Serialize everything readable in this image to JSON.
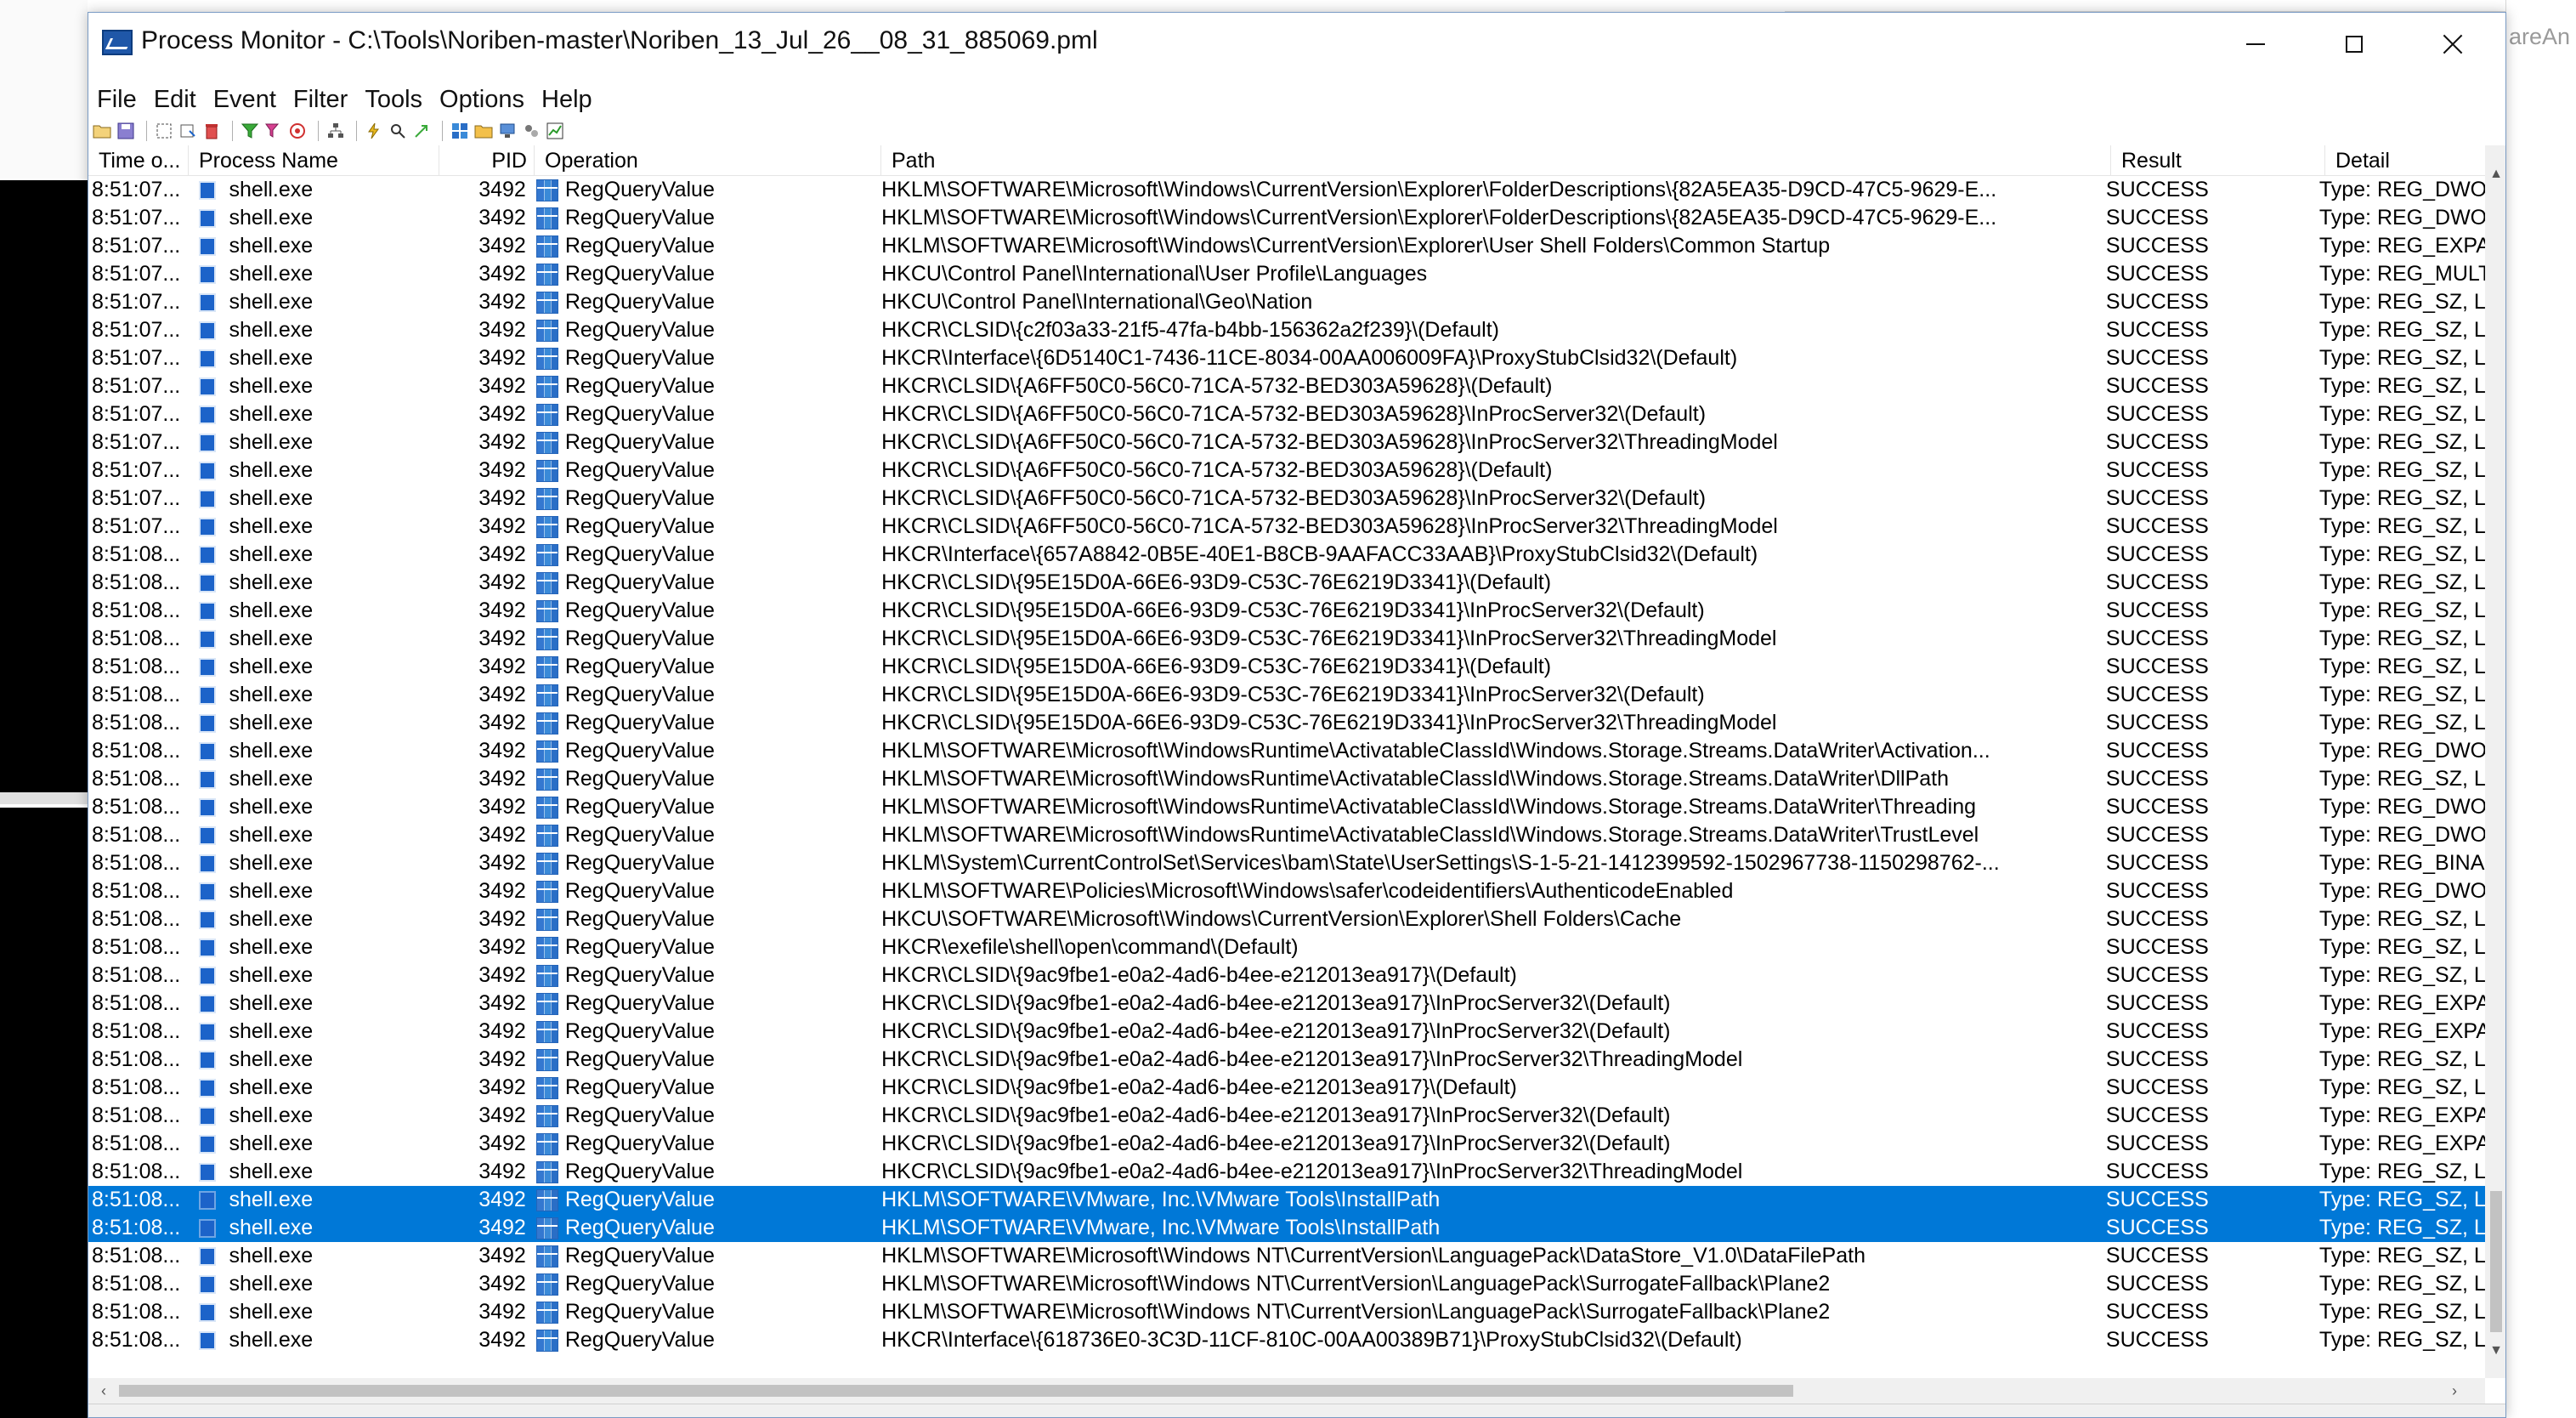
{
  "window": {
    "title": "Process Monitor - C:\\Tools\\Noriben-master\\Noriben_13_Jul_26__08_31_885069.pml",
    "controls": {
      "minimize": "minimize",
      "maximize": "maximize",
      "close": "close"
    }
  },
  "background": {
    "right_text": "areAn"
  },
  "menu": [
    "File",
    "Edit",
    "Event",
    "Filter",
    "Tools",
    "Options",
    "Help"
  ],
  "toolbar": {
    "icons": [
      "open-icon",
      "save-icon",
      "capture-icon",
      "autoscroll-icon",
      "clear-icon",
      "filter-icon",
      "edit-filter-icon",
      "highlight-icon",
      "process-tree-icon",
      "event-properties-icon",
      "find-icon",
      "jump-icon",
      "registry-icon",
      "filesystem-icon",
      "network-icon",
      "process-icon",
      "profiling-icon"
    ]
  },
  "columns": [
    "Time o...",
    "Process Name",
    "PID",
    "Operation",
    "Path",
    "Result",
    "Detail"
  ],
  "rows": [
    {
      "time": "8:51:07...",
      "process": "shell.exe",
      "pid": "3492",
      "op": "RegQueryValue",
      "path": "HKLM\\SOFTWARE\\Microsoft\\Windows\\CurrentVersion\\Explorer\\FolderDescriptions\\{82A5EA35-D9CD-47C5-9629-E...",
      "result": "SUCCESS",
      "detail": "Type: REG_DWOI"
    },
    {
      "time": "8:51:07...",
      "process": "shell.exe",
      "pid": "3492",
      "op": "RegQueryValue",
      "path": "HKLM\\SOFTWARE\\Microsoft\\Windows\\CurrentVersion\\Explorer\\FolderDescriptions\\{82A5EA35-D9CD-47C5-9629-E...",
      "result": "SUCCESS",
      "detail": "Type: REG_DWOI"
    },
    {
      "time": "8:51:07...",
      "process": "shell.exe",
      "pid": "3492",
      "op": "RegQueryValue",
      "path": "HKLM\\SOFTWARE\\Microsoft\\Windows\\CurrentVersion\\Explorer\\User Shell Folders\\Common Startup",
      "result": "SUCCESS",
      "detail": "Type: REG_EXPA"
    },
    {
      "time": "8:51:07...",
      "process": "shell.exe",
      "pid": "3492",
      "op": "RegQueryValue",
      "path": "HKCU\\Control Panel\\International\\User Profile\\Languages",
      "result": "SUCCESS",
      "detail": "Type: REG_MULT"
    },
    {
      "time": "8:51:07...",
      "process": "shell.exe",
      "pid": "3492",
      "op": "RegQueryValue",
      "path": "HKCU\\Control Panel\\International\\Geo\\Nation",
      "result": "SUCCESS",
      "detail": "Type: REG_SZ, Le"
    },
    {
      "time": "8:51:07...",
      "process": "shell.exe",
      "pid": "3492",
      "op": "RegQueryValue",
      "path": "HKCR\\CLSID\\{c2f03a33-21f5-47fa-b4bb-156362a2f239}\\(Default)",
      "result": "SUCCESS",
      "detail": "Type: REG_SZ, Le"
    },
    {
      "time": "8:51:07...",
      "process": "shell.exe",
      "pid": "3492",
      "op": "RegQueryValue",
      "path": "HKCR\\Interface\\{6D5140C1-7436-11CE-8034-00AA006009FA}\\ProxyStubClsid32\\(Default)",
      "result": "SUCCESS",
      "detail": "Type: REG_SZ, Le"
    },
    {
      "time": "8:51:07...",
      "process": "shell.exe",
      "pid": "3492",
      "op": "RegQueryValue",
      "path": "HKCR\\CLSID\\{A6FF50C0-56C0-71CA-5732-BED303A59628}\\(Default)",
      "result": "SUCCESS",
      "detail": "Type: REG_SZ, Le"
    },
    {
      "time": "8:51:07...",
      "process": "shell.exe",
      "pid": "3492",
      "op": "RegQueryValue",
      "path": "HKCR\\CLSID\\{A6FF50C0-56C0-71CA-5732-BED303A59628}\\InProcServer32\\(Default)",
      "result": "SUCCESS",
      "detail": "Type: REG_SZ, Le"
    },
    {
      "time": "8:51:07...",
      "process": "shell.exe",
      "pid": "3492",
      "op": "RegQueryValue",
      "path": "HKCR\\CLSID\\{A6FF50C0-56C0-71CA-5732-BED303A59628}\\InProcServer32\\ThreadingModel",
      "result": "SUCCESS",
      "detail": "Type: REG_SZ, Le"
    },
    {
      "time": "8:51:07...",
      "process": "shell.exe",
      "pid": "3492",
      "op": "RegQueryValue",
      "path": "HKCR\\CLSID\\{A6FF50C0-56C0-71CA-5732-BED303A59628}\\(Default)",
      "result": "SUCCESS",
      "detail": "Type: REG_SZ, Le"
    },
    {
      "time": "8:51:07...",
      "process": "shell.exe",
      "pid": "3492",
      "op": "RegQueryValue",
      "path": "HKCR\\CLSID\\{A6FF50C0-56C0-71CA-5732-BED303A59628}\\InProcServer32\\(Default)",
      "result": "SUCCESS",
      "detail": "Type: REG_SZ, Le"
    },
    {
      "time": "8:51:07...",
      "process": "shell.exe",
      "pid": "3492",
      "op": "RegQueryValue",
      "path": "HKCR\\CLSID\\{A6FF50C0-56C0-71CA-5732-BED303A59628}\\InProcServer32\\ThreadingModel",
      "result": "SUCCESS",
      "detail": "Type: REG_SZ, Le"
    },
    {
      "time": "8:51:08...",
      "process": "shell.exe",
      "pid": "3492",
      "op": "RegQueryValue",
      "path": "HKCR\\Interface\\{657A8842-0B5E-40E1-B8CB-9AAFACC33AAB}\\ProxyStubClsid32\\(Default)",
      "result": "SUCCESS",
      "detail": "Type: REG_SZ, Le"
    },
    {
      "time": "8:51:08...",
      "process": "shell.exe",
      "pid": "3492",
      "op": "RegQueryValue",
      "path": "HKCR\\CLSID\\{95E15D0A-66E6-93D9-C53C-76E6219D3341}\\(Default)",
      "result": "SUCCESS",
      "detail": "Type: REG_SZ, Le"
    },
    {
      "time": "8:51:08...",
      "process": "shell.exe",
      "pid": "3492",
      "op": "RegQueryValue",
      "path": "HKCR\\CLSID\\{95E15D0A-66E6-93D9-C53C-76E6219D3341}\\InProcServer32\\(Default)",
      "result": "SUCCESS",
      "detail": "Type: REG_SZ, Le"
    },
    {
      "time": "8:51:08...",
      "process": "shell.exe",
      "pid": "3492",
      "op": "RegQueryValue",
      "path": "HKCR\\CLSID\\{95E15D0A-66E6-93D9-C53C-76E6219D3341}\\InProcServer32\\ThreadingModel",
      "result": "SUCCESS",
      "detail": "Type: REG_SZ, Le"
    },
    {
      "time": "8:51:08...",
      "process": "shell.exe",
      "pid": "3492",
      "op": "RegQueryValue",
      "path": "HKCR\\CLSID\\{95E15D0A-66E6-93D9-C53C-76E6219D3341}\\(Default)",
      "result": "SUCCESS",
      "detail": "Type: REG_SZ, Le"
    },
    {
      "time": "8:51:08...",
      "process": "shell.exe",
      "pid": "3492",
      "op": "RegQueryValue",
      "path": "HKCR\\CLSID\\{95E15D0A-66E6-93D9-C53C-76E6219D3341}\\InProcServer32\\(Default)",
      "result": "SUCCESS",
      "detail": "Type: REG_SZ, Le"
    },
    {
      "time": "8:51:08...",
      "process": "shell.exe",
      "pid": "3492",
      "op": "RegQueryValue",
      "path": "HKCR\\CLSID\\{95E15D0A-66E6-93D9-C53C-76E6219D3341}\\InProcServer32\\ThreadingModel",
      "result": "SUCCESS",
      "detail": "Type: REG_SZ, Le"
    },
    {
      "time": "8:51:08...",
      "process": "shell.exe",
      "pid": "3492",
      "op": "RegQueryValue",
      "path": "HKLM\\SOFTWARE\\Microsoft\\WindowsRuntime\\ActivatableClassId\\Windows.Storage.Streams.DataWriter\\Activation...",
      "result": "SUCCESS",
      "detail": "Type: REG_DWOI"
    },
    {
      "time": "8:51:08...",
      "process": "shell.exe",
      "pid": "3492",
      "op": "RegQueryValue",
      "path": "HKLM\\SOFTWARE\\Microsoft\\WindowsRuntime\\ActivatableClassId\\Windows.Storage.Streams.DataWriter\\DllPath",
      "result": "SUCCESS",
      "detail": "Type: REG_SZ, Le"
    },
    {
      "time": "8:51:08...",
      "process": "shell.exe",
      "pid": "3492",
      "op": "RegQueryValue",
      "path": "HKLM\\SOFTWARE\\Microsoft\\WindowsRuntime\\ActivatableClassId\\Windows.Storage.Streams.DataWriter\\Threading",
      "result": "SUCCESS",
      "detail": "Type: REG_DWOI"
    },
    {
      "time": "8:51:08...",
      "process": "shell.exe",
      "pid": "3492",
      "op": "RegQueryValue",
      "path": "HKLM\\SOFTWARE\\Microsoft\\WindowsRuntime\\ActivatableClassId\\Windows.Storage.Streams.DataWriter\\TrustLevel",
      "result": "SUCCESS",
      "detail": "Type: REG_DWOI"
    },
    {
      "time": "8:51:08...",
      "process": "shell.exe",
      "pid": "3492",
      "op": "RegQueryValue",
      "path": "HKLM\\System\\CurrentControlSet\\Services\\bam\\State\\UserSettings\\S-1-5-21-1412399592-1502967738-1150298762-...",
      "result": "SUCCESS",
      "detail": "Type: REG_BINAI"
    },
    {
      "time": "8:51:08...",
      "process": "shell.exe",
      "pid": "3492",
      "op": "RegQueryValue",
      "path": "HKLM\\SOFTWARE\\Policies\\Microsoft\\Windows\\safer\\codeidentifiers\\AuthenticodeEnabled",
      "result": "SUCCESS",
      "detail": "Type: REG_DWOI"
    },
    {
      "time": "8:51:08...",
      "process": "shell.exe",
      "pid": "3492",
      "op": "RegQueryValue",
      "path": "HKCU\\SOFTWARE\\Microsoft\\Windows\\CurrentVersion\\Explorer\\Shell Folders\\Cache",
      "result": "SUCCESS",
      "detail": "Type: REG_SZ, Le"
    },
    {
      "time": "8:51:08...",
      "process": "shell.exe",
      "pid": "3492",
      "op": "RegQueryValue",
      "path": "HKCR\\exefile\\shell\\open\\command\\(Default)",
      "result": "SUCCESS",
      "detail": "Type: REG_SZ, Le"
    },
    {
      "time": "8:51:08...",
      "process": "shell.exe",
      "pid": "3492",
      "op": "RegQueryValue",
      "path": "HKCR\\CLSID\\{9ac9fbe1-e0a2-4ad6-b4ee-e212013ea917}\\(Default)",
      "result": "SUCCESS",
      "detail": "Type: REG_SZ, Le"
    },
    {
      "time": "8:51:08...",
      "process": "shell.exe",
      "pid": "3492",
      "op": "RegQueryValue",
      "path": "HKCR\\CLSID\\{9ac9fbe1-e0a2-4ad6-b4ee-e212013ea917}\\InProcServer32\\(Default)",
      "result": "SUCCESS",
      "detail": "Type: REG_EXPA"
    },
    {
      "time": "8:51:08...",
      "process": "shell.exe",
      "pid": "3492",
      "op": "RegQueryValue",
      "path": "HKCR\\CLSID\\{9ac9fbe1-e0a2-4ad6-b4ee-e212013ea917}\\InProcServer32\\(Default)",
      "result": "SUCCESS",
      "detail": "Type: REG_EXPA"
    },
    {
      "time": "8:51:08...",
      "process": "shell.exe",
      "pid": "3492",
      "op": "RegQueryValue",
      "path": "HKCR\\CLSID\\{9ac9fbe1-e0a2-4ad6-b4ee-e212013ea917}\\InProcServer32\\ThreadingModel",
      "result": "SUCCESS",
      "detail": "Type: REG_SZ, Le"
    },
    {
      "time": "8:51:08...",
      "process": "shell.exe",
      "pid": "3492",
      "op": "RegQueryValue",
      "path": "HKCR\\CLSID\\{9ac9fbe1-e0a2-4ad6-b4ee-e212013ea917}\\(Default)",
      "result": "SUCCESS",
      "detail": "Type: REG_SZ, Le"
    },
    {
      "time": "8:51:08...",
      "process": "shell.exe",
      "pid": "3492",
      "op": "RegQueryValue",
      "path": "HKCR\\CLSID\\{9ac9fbe1-e0a2-4ad6-b4ee-e212013ea917}\\InProcServer32\\(Default)",
      "result": "SUCCESS",
      "detail": "Type: REG_EXPA"
    },
    {
      "time": "8:51:08...",
      "process": "shell.exe",
      "pid": "3492",
      "op": "RegQueryValue",
      "path": "HKCR\\CLSID\\{9ac9fbe1-e0a2-4ad6-b4ee-e212013ea917}\\InProcServer32\\(Default)",
      "result": "SUCCESS",
      "detail": "Type: REG_EXPA"
    },
    {
      "time": "8:51:08...",
      "process": "shell.exe",
      "pid": "3492",
      "op": "RegQueryValue",
      "path": "HKCR\\CLSID\\{9ac9fbe1-e0a2-4ad6-b4ee-e212013ea917}\\InProcServer32\\ThreadingModel",
      "result": "SUCCESS",
      "detail": "Type: REG_SZ, Le"
    },
    {
      "time": "8:51:08...",
      "process": "shell.exe",
      "pid": "3492",
      "op": "RegQueryValue",
      "path": "HKLM\\SOFTWARE\\VMware, Inc.\\VMware Tools\\InstallPath",
      "result": "SUCCESS",
      "detail": "Type: REG_SZ, Le",
      "selected": true
    },
    {
      "time": "8:51:08...",
      "process": "shell.exe",
      "pid": "3492",
      "op": "RegQueryValue",
      "path": "HKLM\\SOFTWARE\\VMware, Inc.\\VMware Tools\\InstallPath",
      "result": "SUCCESS",
      "detail": "Type: REG_SZ, Le",
      "selected": true
    },
    {
      "time": "8:51:08...",
      "process": "shell.exe",
      "pid": "3492",
      "op": "RegQueryValue",
      "path": "HKLM\\SOFTWARE\\Microsoft\\Windows NT\\CurrentVersion\\LanguagePack\\DataStore_V1.0\\DataFilePath",
      "result": "SUCCESS",
      "detail": "Type: REG_SZ, Le"
    },
    {
      "time": "8:51:08...",
      "process": "shell.exe",
      "pid": "3492",
      "op": "RegQueryValue",
      "path": "HKLM\\SOFTWARE\\Microsoft\\Windows NT\\CurrentVersion\\LanguagePack\\SurrogateFallback\\Plane2",
      "result": "SUCCESS",
      "detail": "Type: REG_SZ, Le"
    },
    {
      "time": "8:51:08...",
      "process": "shell.exe",
      "pid": "3492",
      "op": "RegQueryValue",
      "path": "HKLM\\SOFTWARE\\Microsoft\\Windows NT\\CurrentVersion\\LanguagePack\\SurrogateFallback\\Plane2",
      "result": "SUCCESS",
      "detail": "Type: REG_SZ, Le"
    },
    {
      "time": "8:51:08...",
      "process": "shell.exe",
      "pid": "3492",
      "op": "RegQueryValue",
      "path": "HKCR\\Interface\\{618736E0-3C3D-11CF-810C-00AA00389B71}\\ProxyStubClsid32\\(Default)",
      "result": "SUCCESS",
      "detail": "Type: REG_SZ, Le"
    }
  ],
  "colors": {
    "selection": "#0078d7",
    "accent": "#1c63c9"
  }
}
